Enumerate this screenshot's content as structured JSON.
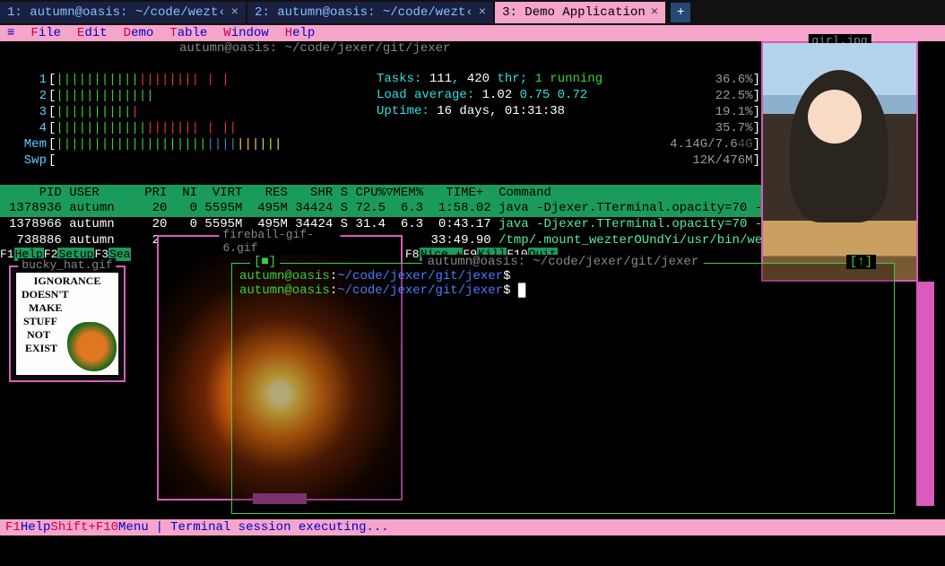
{
  "tabs": [
    {
      "label": "1: autumn@oasis: ~/code/wezt‹",
      "active": false
    },
    {
      "label": "2: autumn@oasis: ~/code/wezt‹",
      "active": false
    },
    {
      "label": "3: Demo Application",
      "active": true
    }
  ],
  "menubar": {
    "burger": "≡",
    "items": [
      {
        "hot": "F",
        "rest": "ile"
      },
      {
        "hot": "E",
        "rest": "dit"
      },
      {
        "hot": "D",
        "rest": "emo"
      },
      {
        "hot": "T",
        "rest": "able"
      },
      {
        "hot": "W",
        "rest": "indow"
      },
      {
        "hot": "H",
        "rest": "elp"
      }
    ]
  },
  "main_title": "autumn@oasis: ~/code/jexer/git/jexer",
  "cpus": [
    {
      "n": "1",
      "bars_g": "|||||||||||",
      "bars_r": "|||||||| | |",
      "pct": "36.6%"
    },
    {
      "n": "2",
      "bars_g": "|||||||||||||",
      "bars_r": "",
      "pct": "22.5%"
    },
    {
      "n": "3",
      "bars_g": "||||||||||",
      "bars_r": " |",
      "pct": "19.1%"
    },
    {
      "n": "4",
      "bars_g": "||||||||||||",
      "bars_r": "||||||| | ||",
      "pct": "35.7%"
    }
  ],
  "mem": {
    "label": "Mem",
    "bars_g": "||||||||||||||||||||",
    "bars_b": "||||",
    "bars_y": "||||||",
    "text": "4.14G/7.6",
    "suffix": "4G"
  },
  "swp": {
    "label": "Swp",
    "bars": "",
    "text": "12K/476M"
  },
  "stats": {
    "tasks_label": "Tasks:",
    "tasks": "111",
    "tasks_sep": ",",
    "threads": "420",
    "thr_label": "thr;",
    "running": "1 running",
    "load_label": "Load average:",
    "load1": "1.02",
    "load2": "0.75",
    "load3": "0.72",
    "uptime_label": "Uptime:",
    "uptime": "16 days, 01:31:38"
  },
  "table": {
    "header": "    PID USER      PRI  NI  VIRT   RES   SHR S CPU%▽MEM%   TIME+  Command",
    "rows": [
      {
        "sel": true,
        "text": "1378936 autumn     20   0 5595M  495M 34424 S 72.5  6.3  1:58.02 java -Djexer.TTerminal.opacity=70 -Djexe"
      },
      {
        "sel": false,
        "pre": "1378966 autumn     20   0 5595M  495M 34424 S 31.4  6.3  0:43.17 ",
        "cmd": "java -Djexer.TTerminal.opacity=70 -Djexe"
      },
      {
        "sel": false,
        "pre": " 738886 autumn     20                                   33:49.90 ",
        "cmd": "/tmp/.mount_wezterOUndYi/usr/bin/wezterm"
      }
    ]
  },
  "fnkeys": [
    {
      "fn": "F1",
      "lbl": "Help "
    },
    {
      "fn": "F2",
      "lbl": "Setup "
    },
    {
      "fn": "F3",
      "lbl": "Sea"
    },
    {
      "fn": "F8",
      "lbl": "Nice +"
    },
    {
      "fn": "F9",
      "lbl": "Kill "
    },
    {
      "fn": "F10",
      "lbl": "Quit "
    }
  ],
  "windows": {
    "bucky": {
      "title": "bucky_hat.gif",
      "text1": "IGNORANCE",
      "text2": "DOESN'T",
      "text3": "MAKE",
      "text4": "STUFF",
      "text5": "NOT",
      "text6": "EXIST"
    },
    "fireball": {
      "title": "fireball-gif-6.gif"
    },
    "girl": {
      "title": "girl.jpg"
    }
  },
  "terminal": {
    "title": "autumn@oasis: ~/code/jexer/git/jexer",
    "close": "[■]",
    "max": "[↑]",
    "lines": [
      {
        "user": "autumn@oasis",
        "path": "~/code/jexer/git/jexer",
        "dollar": "$"
      },
      {
        "user": "autumn@oasis",
        "path": "~/code/jexer/git/jexer",
        "dollar": "$",
        "cursor": "█"
      }
    ]
  },
  "statusbar": {
    "f1": "F1",
    "f1_lbl": " Help",
    "sep1": "  ",
    "sf10": "Shift+F10",
    "sf10_lbl": " Menu",
    "sep2": " | ",
    "msg": "Terminal session executing..."
  }
}
